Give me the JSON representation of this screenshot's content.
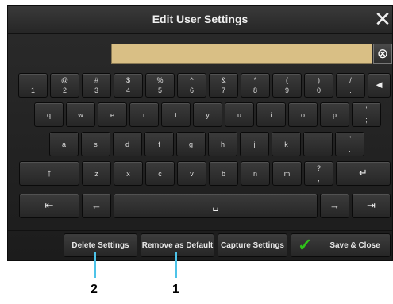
{
  "dialog": {
    "title": "Edit User Settings",
    "close_icon": "✕",
    "clear_icon": "⊗"
  },
  "keyboard": {
    "row1": [
      {
        "top": "!",
        "bottom": "1"
      },
      {
        "top": "@",
        "bottom": "2"
      },
      {
        "top": "#",
        "bottom": "3"
      },
      {
        "top": "$",
        "bottom": "4"
      },
      {
        "top": "%",
        "bottom": "5"
      },
      {
        "top": "^",
        "bottom": "6"
      },
      {
        "top": "&",
        "bottom": "7"
      },
      {
        "top": "*",
        "bottom": "8"
      },
      {
        "top": "(",
        "bottom": "9"
      },
      {
        "top": ")",
        "bottom": "0"
      },
      {
        "top": "/",
        "bottom": "."
      }
    ],
    "backspace_icon": "◄",
    "row2": [
      "q",
      "w",
      "e",
      "r",
      "t",
      "y",
      "u",
      "i",
      "o",
      "p"
    ],
    "row2_punct": {
      "top": "'",
      "bottom": ";"
    },
    "row3": [
      "a",
      "s",
      "d",
      "f",
      "g",
      "h",
      "j",
      "k",
      "l"
    ],
    "row3_punct": {
      "top": "\"",
      "bottom": ":"
    },
    "shift_icon": "↑",
    "row4": [
      "z",
      "x",
      "c",
      "v",
      "b",
      "n",
      "m"
    ],
    "row4_punct": {
      "top": "?",
      "bottom": ","
    },
    "enter_icon": "↵",
    "home_icon": "⇤",
    "left_icon": "←",
    "space_icon": "␣",
    "right_icon": "→",
    "end_icon": "⇥"
  },
  "actions": {
    "delete": "Delete Settings",
    "remove_default": "Remove as Default",
    "capture": "Capture Settings",
    "save_close": "Save & Close",
    "check_icon": "✓"
  },
  "callouts": {
    "one": "1",
    "two": "2"
  },
  "colors": {
    "field": "#d9bf85",
    "check": "#2fc21a",
    "callout": "#4dc3e8"
  }
}
